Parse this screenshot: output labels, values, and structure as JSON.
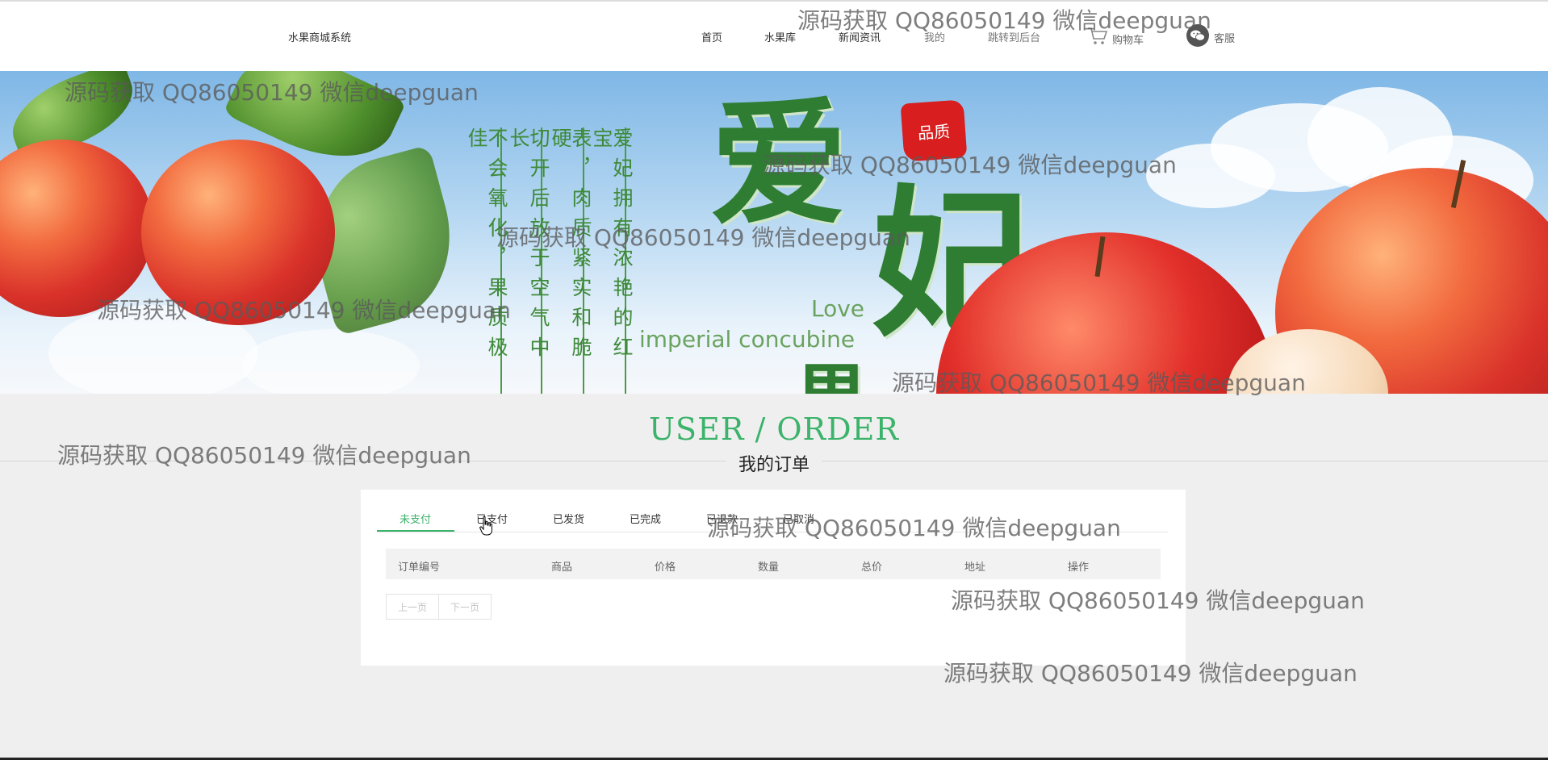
{
  "header": {
    "brand": "水果商城系统",
    "nav": [
      {
        "label": "首页"
      },
      {
        "label": "水果库"
      },
      {
        "label": "新闻资讯"
      },
      {
        "label": "我的"
      },
      {
        "label": "跳转到后台"
      }
    ],
    "cart_label": "购物车",
    "service_label": "客服"
  },
  "banner": {
    "big_chars": [
      "爱",
      "妃",
      "果"
    ],
    "stamp_text": "品质",
    "love_text": "Love",
    "imperial_text": "imperial concubine",
    "poem_columns": [
      "爱妃拥有浓艳的红宝",
      "表，肉质紧实和脆硬",
      "切开后放于空气中长",
      "不会氧化，果质极佳"
    ]
  },
  "section": {
    "title": "USER / ORDER",
    "subtitle": "我的订单"
  },
  "orders": {
    "tabs": [
      {
        "label": "未支付",
        "active": true
      },
      {
        "label": "已支付",
        "active": false
      },
      {
        "label": "已发货",
        "active": false
      },
      {
        "label": "已完成",
        "active": false
      },
      {
        "label": "已退款",
        "active": false
      },
      {
        "label": "已取消",
        "active": false
      }
    ],
    "columns": [
      "订单编号",
      "商品",
      "价格",
      "数量",
      "总价",
      "地址",
      "操作"
    ],
    "prev_label": "上一页",
    "next_label": "下一页"
  },
  "watermark": "源码获取 QQ86050149 微信deepguan",
  "colors": {
    "accent": "#3bb36a",
    "background": "#efefef",
    "poem_green": "#3f8a3a"
  }
}
